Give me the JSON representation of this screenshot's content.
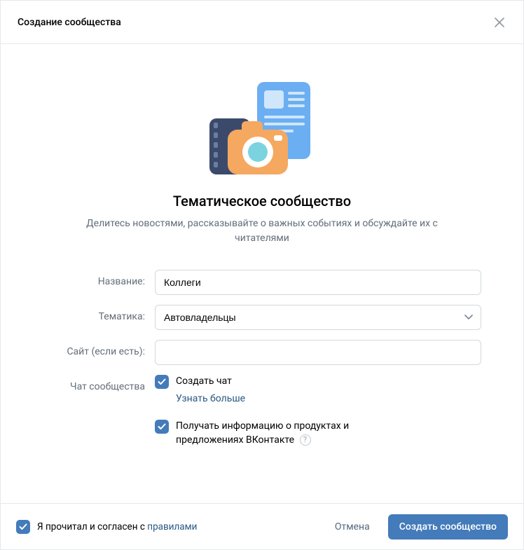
{
  "header": {
    "title": "Создание сообщества"
  },
  "hero": {
    "title": "Тематическое сообщество",
    "subtitle": "Делитесь новостями, рассказывайте о важных событиях и обсуждайте их с читателями"
  },
  "form": {
    "name_label": "Название:",
    "name_value": "Коллеги",
    "topic_label": "Тематика:",
    "topic_value": "Автовладельцы",
    "site_label": "Сайт (если есть):",
    "site_value": "",
    "chat_label": "Чат сообщества",
    "create_chat_label": "Создать чат",
    "learn_more": "Узнать больше",
    "marketing_label": "Получать информацию о продуктах и предложениях ВКонтакте"
  },
  "footer": {
    "agree_prefix": "Я прочитал и согласен с ",
    "rules_link": "правилами",
    "cancel": "Отмена",
    "submit": "Создать сообщество"
  }
}
